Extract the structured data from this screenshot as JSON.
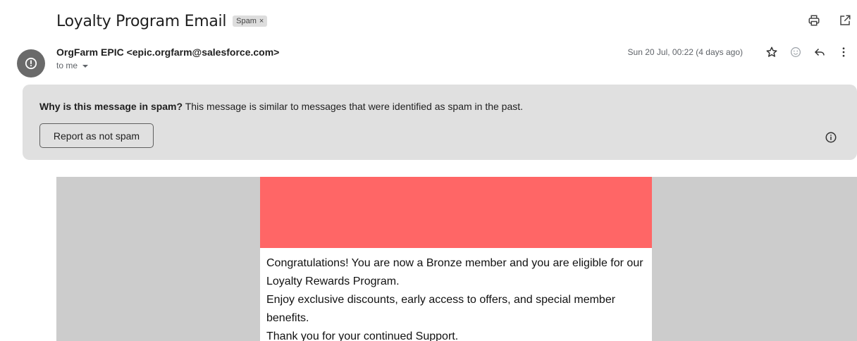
{
  "email": {
    "subject": "Loyalty Program Email",
    "label": "Spam",
    "label_remove": "×",
    "sender": "OrgFarm EPIC <epic.orgfarm@salesforce.com>",
    "recipient": "to me",
    "date": "Sun 20 Jul, 00:22 (4 days ago)"
  },
  "icons": {
    "print": "print-icon",
    "open_new": "open-in-new-window-icon",
    "star": "star-icon",
    "emoji": "emoji-reaction-icon",
    "reply": "reply-icon",
    "more": "more-vertical-icon",
    "sender_avatar": "warning-avatar-icon",
    "info": "info-icon"
  },
  "spam_notice": {
    "question": "Why is this message in spam?",
    "explanation": " This message is similar to messages that were identified as spam in the past.",
    "button": "Report as not spam"
  },
  "body": {
    "paragraph1": "Congratulations! You are now a Bronze member and you are eligible for our Loyalty Rewards Program.",
    "paragraph2": "Enjoy exclusive discounts, early access to offers, and special member benefits.",
    "paragraph3": "Thank you for your continued Support."
  },
  "colors": {
    "banner": "#ff6666",
    "spam_box": "#e0e0e0",
    "email_background": "#cccccc",
    "avatar": "#6a6a6a"
  }
}
